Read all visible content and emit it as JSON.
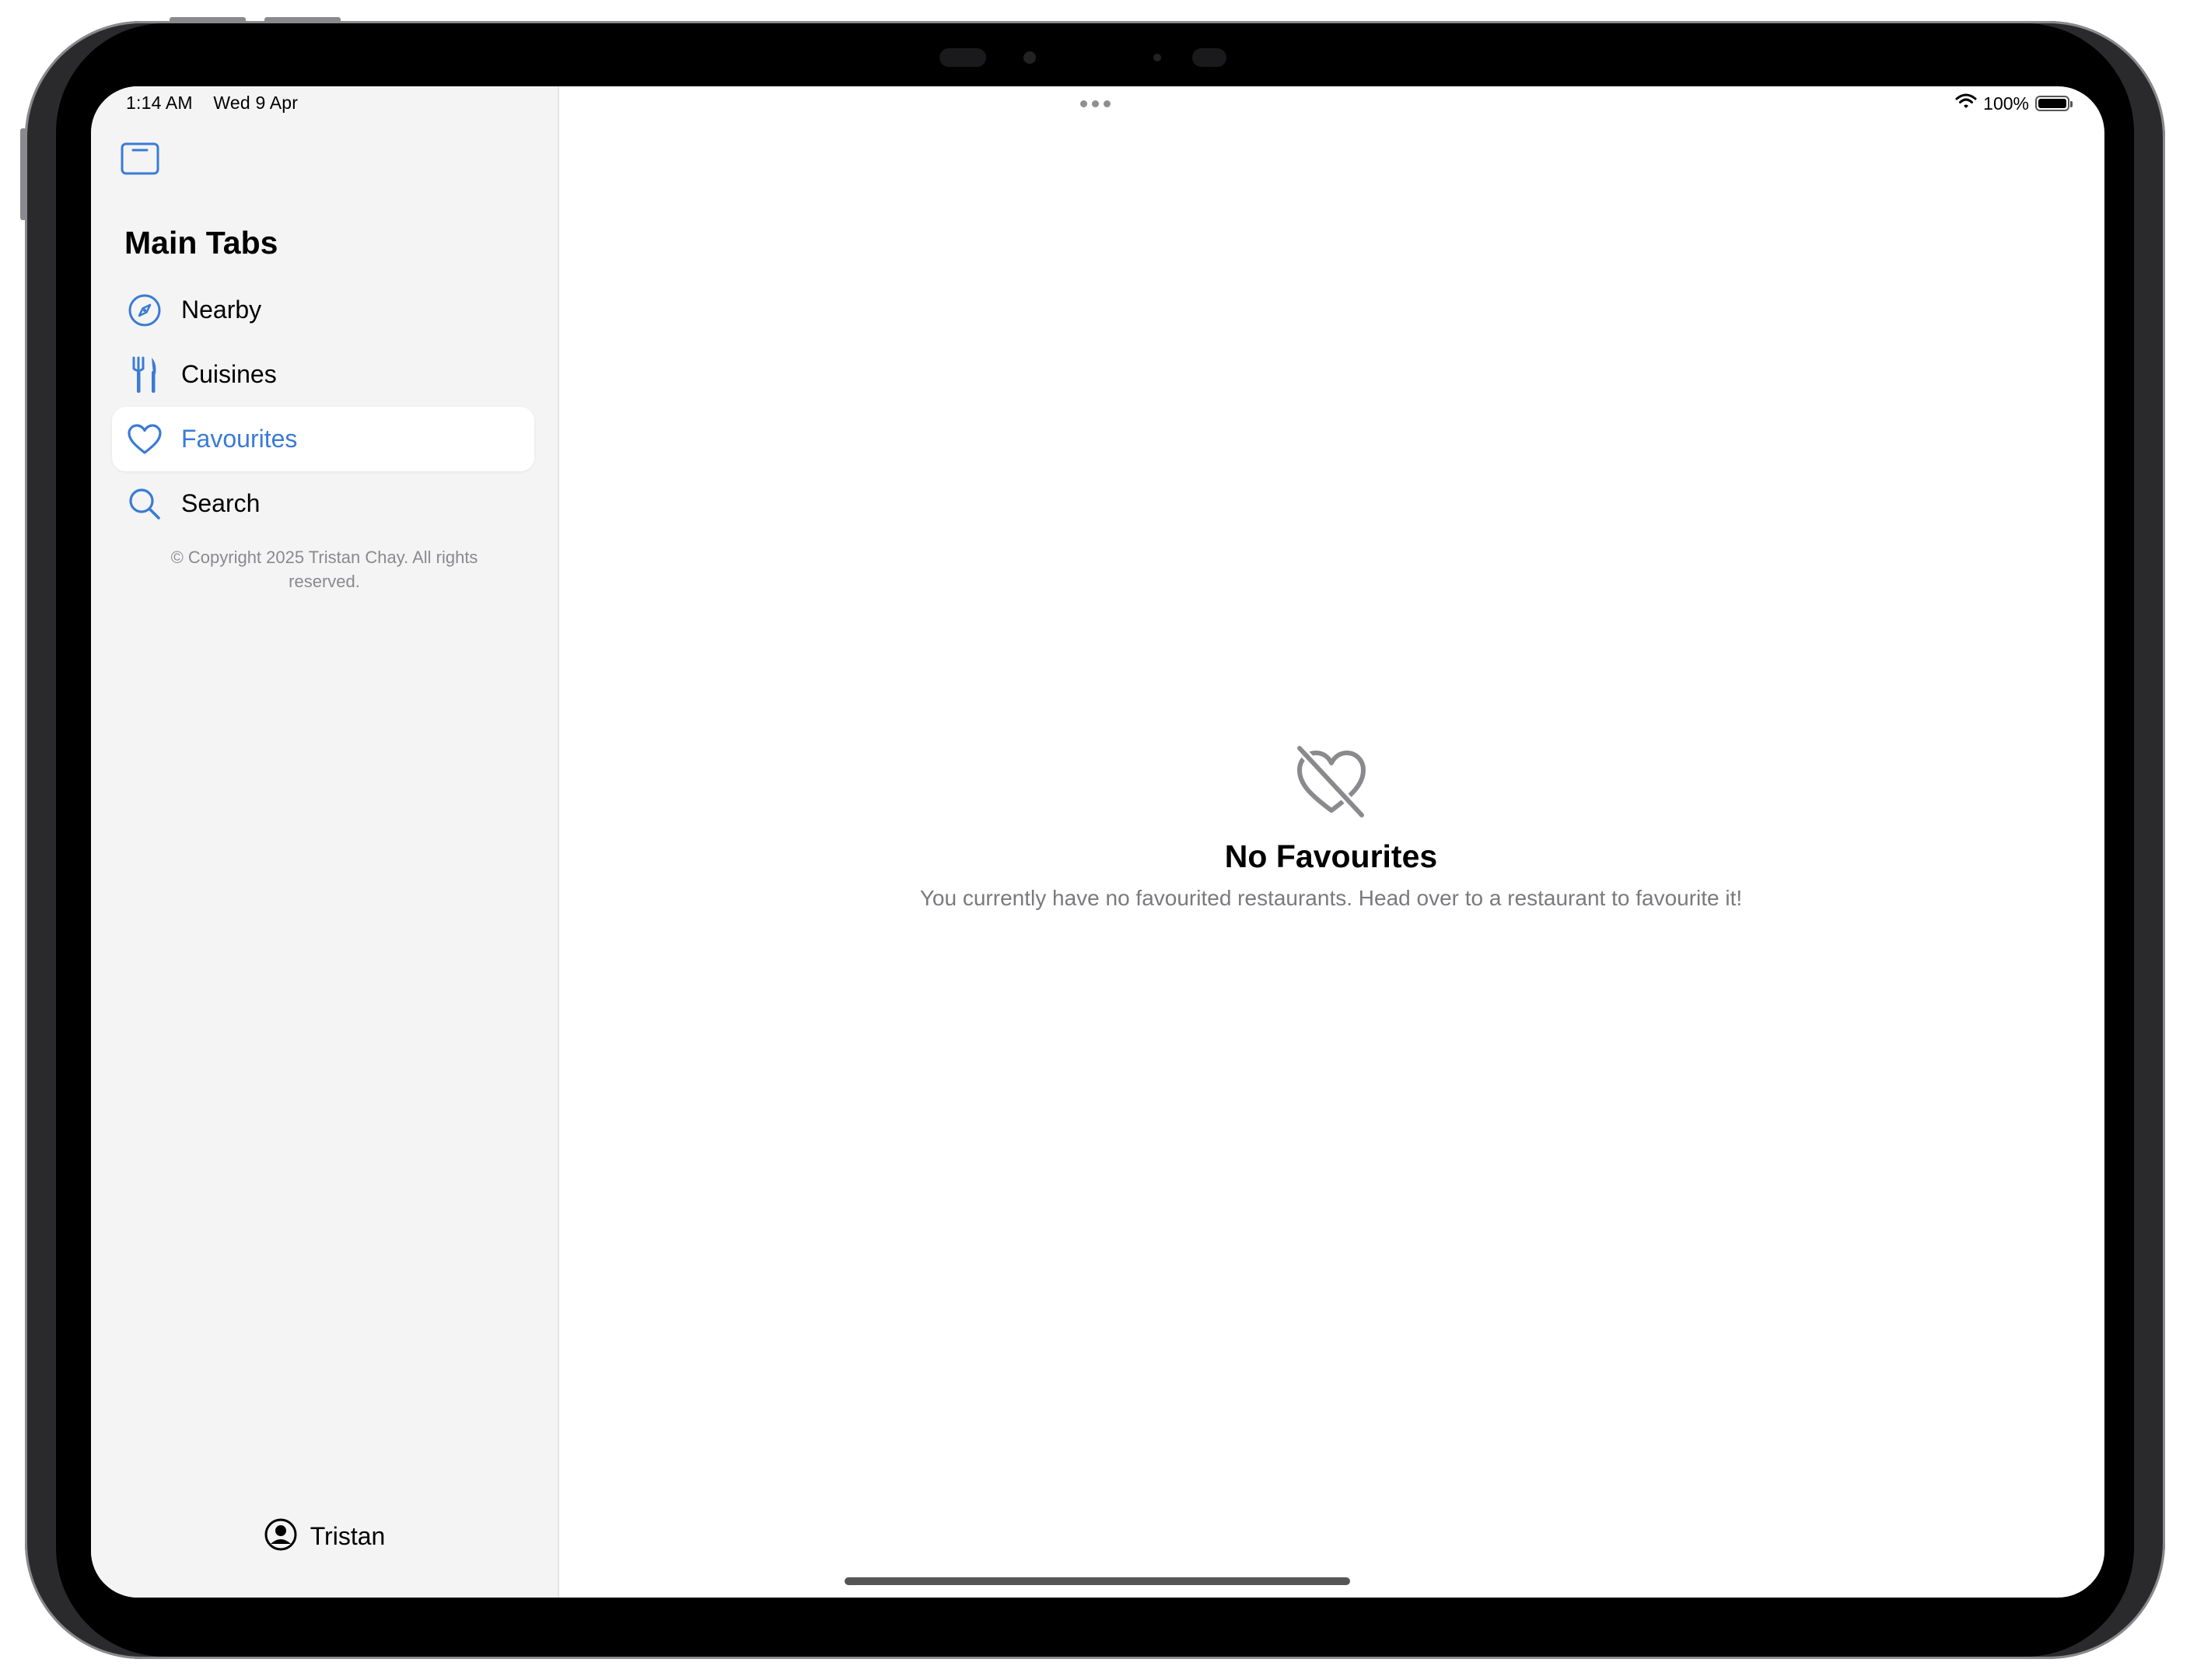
{
  "status_bar": {
    "time": "1:14 AM",
    "date": "Wed 9 Apr",
    "battery": "100%",
    "battery_level": 1.0
  },
  "sidebar": {
    "toggle_icon": "sidebar-toggle-icon",
    "section_title": "Main Tabs",
    "items": [
      {
        "label": "Nearby",
        "icon": "compass-icon",
        "selected": false
      },
      {
        "label": "Cuisines",
        "icon": "fork-knife-icon",
        "selected": false
      },
      {
        "label": "Favourites",
        "icon": "heart-icon",
        "selected": true
      },
      {
        "label": "Search",
        "icon": "magnifying-glass-icon",
        "selected": false
      }
    ],
    "copyright": "© Copyright 2025 Tristan Chay. All rights reserved.",
    "profile": {
      "name": "Tristan",
      "icon": "person-circle-icon"
    }
  },
  "main": {
    "empty_state": {
      "icon": "heart-slash-icon",
      "title": "No Favourites",
      "description": "You currently have no favourited restaurants. Head over to a restaurant to favourite it!"
    }
  },
  "colors": {
    "accent": "#3a7bd5",
    "sidebar_background": "#f4f4f5",
    "secondary_text": "#7a7a7e"
  }
}
